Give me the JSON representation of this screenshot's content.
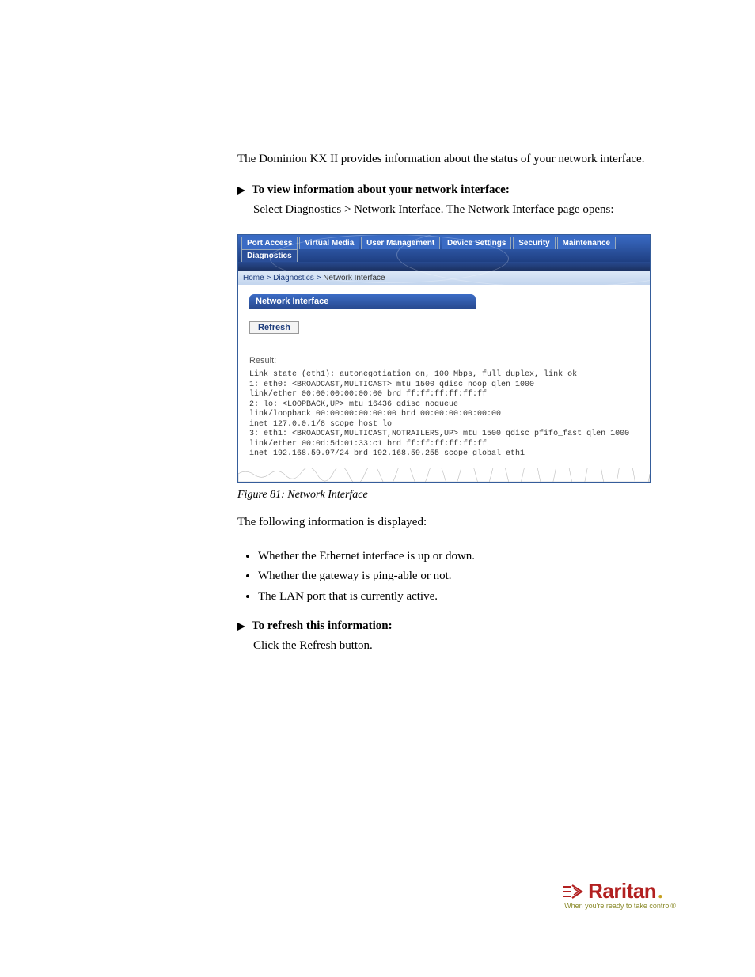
{
  "intro": "The Dominion KX II provides information about the status of your network interface.",
  "procedure1": {
    "heading": "To view information about your network interface:",
    "step": "Select Diagnostics > Network Interface. The Network Interface page opens:"
  },
  "screenshot": {
    "tabs": [
      "Port Access",
      "Virtual Media",
      "User Management",
      "Device Settings",
      "Security",
      "Maintenance",
      "Diagnostics"
    ],
    "active_tab": "Diagnostics",
    "crumb": {
      "home": "Home",
      "diag": "Diagnostics",
      "cur": "Network Interface"
    },
    "panel_title": "Network Interface",
    "refresh_label": "Refresh",
    "result_label": "Result:",
    "result_text": "Link state (eth1): autonegotiation on, 100 Mbps, full duplex, link ok\n1: eth0: <BROADCAST,MULTICAST> mtu 1500 qdisc noop qlen 1000\nlink/ether 00:00:00:00:00:00 brd ff:ff:ff:ff:ff:ff\n2: lo: <LOOPBACK,UP> mtu 16436 qdisc noqueue\nlink/loopback 00:00:00:00:00:00 brd 00:00:00:00:00:00\ninet 127.0.0.1/8 scope host lo\n3: eth1: <BROADCAST,MULTICAST,NOTRAILERS,UP> mtu 1500 qdisc pfifo_fast qlen 1000\nlink/ether 00:0d:5d:01:33:c1 brd ff:ff:ff:ff:ff:ff\ninet 192.168.59.97/24 brd 192.168.59.255 scope global eth1"
  },
  "figure_caption": "Figure 81: Network Interface",
  "displayed_heading": "The following information is displayed:",
  "bullets": [
    "Whether the Ethernet interface is up or down.",
    "Whether the gateway is ping-able or not.",
    "The LAN port that is currently active."
  ],
  "procedure2": {
    "heading": "To refresh this information:",
    "step": "Click the Refresh button."
  },
  "logo": {
    "brand": "Raritan",
    "tagline": "When you're ready to take control®"
  }
}
